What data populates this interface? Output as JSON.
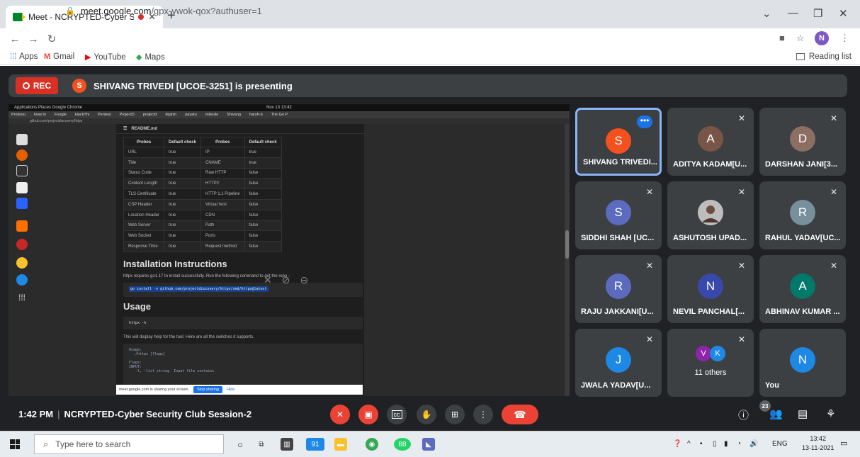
{
  "browser": {
    "tab_title": "Meet - NCRYPTED-Cyber Se",
    "url_host": "meet.google.com",
    "url_path": "/gpx-vwok-qox?authuser=1",
    "profile_initial": "N",
    "bookmarks": [
      "Apps",
      "Gmail",
      "YouTube",
      "Maps"
    ],
    "reading_list": "Reading list"
  },
  "meet": {
    "rec_label": "REC",
    "presenter_initial": "S",
    "presenting_text": "SHIVANG TRIVEDI [UCOE-3251] is presenting",
    "meeting_time": "1:42 PM",
    "meeting_name": "NCRYPTED-Cyber Security Club Session-2",
    "participant_count": "23",
    "others_count_label": "11 others",
    "tiles": [
      {
        "initial": "S",
        "name": "SHIVANG TRIVEDI...",
        "color": "#f4511e"
      },
      {
        "initial": "A",
        "name": "ADITYA KADAM[U...",
        "color": "#795548"
      },
      {
        "initial": "D",
        "name": "DARSHAN JANI[3...",
        "color": "#8d6e63"
      },
      {
        "initial": "S",
        "name": "SIDDHI SHAH [UC...",
        "color": "#5c6bc0"
      },
      {
        "initial": "",
        "name": "ASHUTOSH UPAD...",
        "color": "#9e9e9e"
      },
      {
        "initial": "R",
        "name": "RAHUL YADAV[UC...",
        "color": "#78909c"
      },
      {
        "initial": "R",
        "name": "RAJU JAKKANI[U...",
        "color": "#5c6bc0"
      },
      {
        "initial": "N",
        "name": "NEVIL PANCHAL[...",
        "color": "#3949ab"
      },
      {
        "initial": "A",
        "name": "ABHINAV KUMAR ...",
        "color": "#00796b"
      },
      {
        "initial": "J",
        "name": "JWALA YADAV[U...",
        "color": "#1e88e5"
      },
      {
        "initial": "N",
        "name": "You",
        "color": "#1e88e5"
      }
    ],
    "others_avatars": [
      "V",
      "K"
    ]
  },
  "shared": {
    "topbar_left": "Applications   Places   Google Chrome",
    "topbar_time": "Nov 13 13:42",
    "tabs": [
      "Professi",
      "How to",
      "Foogle",
      "HackThi",
      "Pentest",
      "ProjectD",
      "projectd",
      "diginin",
      "payatu",
      "mikeski",
      "Shivang",
      "harsh-b",
      "The Go P"
    ],
    "url": "github.com/projectdiscovery/httpx",
    "readme_label": "README.md",
    "table_headers": [
      "Probes",
      "Default check",
      "Probes",
      "Default check"
    ],
    "table_rows": [
      [
        "URL",
        "true",
        "IP",
        "true"
      ],
      [
        "Title",
        "true",
        "CNAME",
        "true"
      ],
      [
        "Status Code",
        "true",
        "Raw HTTP",
        "false"
      ],
      [
        "Content Length",
        "true",
        "HTTP2",
        "false"
      ],
      [
        "TLS Certificate",
        "true",
        "HTTP 1.1 Pipeline",
        "false"
      ],
      [
        "CSP Header",
        "true",
        "Virtual host",
        "false"
      ],
      [
        "Location Header",
        "true",
        "CDN",
        "false"
      ],
      [
        "Web Server",
        "true",
        "Path",
        "false"
      ],
      [
        "Web Socket",
        "true",
        "Ports",
        "false"
      ],
      [
        "Response Time",
        "true",
        "Request method",
        "false"
      ]
    ],
    "h_install": "Installation Instructions",
    "install_text": "httpx requires go1.17 to install successfully. Run the following command to get the repo -",
    "install_cmd": "go install -v github.com/projectdiscovery/httpx/cmd/httpx@latest",
    "h_usage": "Usage",
    "usage_cmd": "httpx -h",
    "usage_text": "This will display help for the tool. Here are all the switches it supports.",
    "usage_block": "Usage:\n  ./httpx [flags]\n\nFlags:\nINPUT:\n   -l, -list string  Input file containi",
    "share_text": "meet.google.com is sharing your screen.",
    "stop_sharing": "Stop sharing",
    "hide": "Hide"
  },
  "taskbar": {
    "search_placeholder": "Type here to search",
    "lang": "ENG",
    "time": "13:42",
    "date": "13-11-2021",
    "badge_91": "91",
    "badge_88": "88"
  }
}
